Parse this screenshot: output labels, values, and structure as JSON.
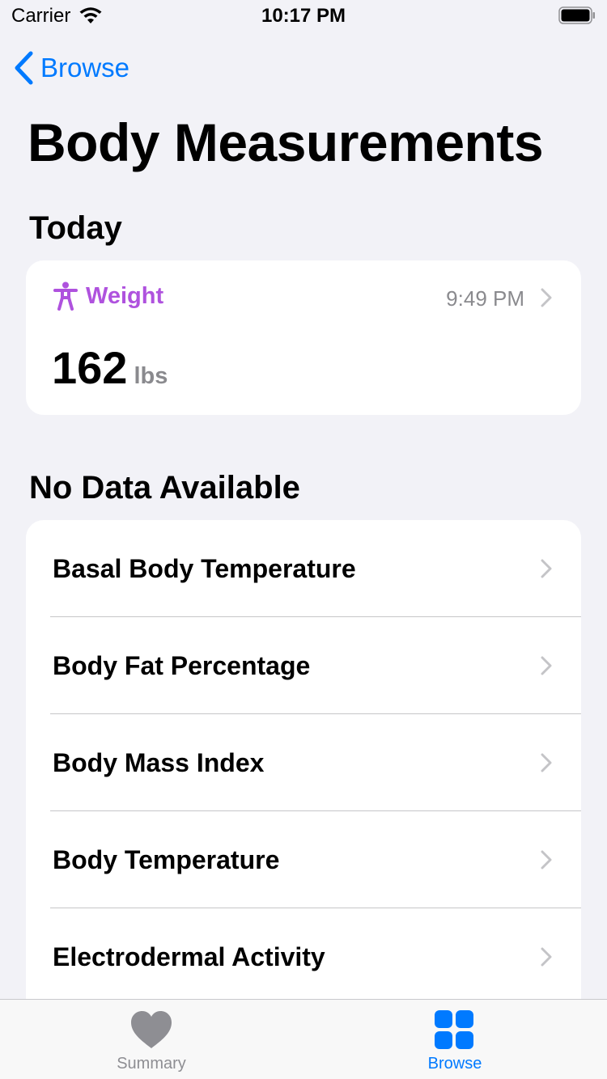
{
  "status_bar": {
    "carrier": "Carrier",
    "time": "10:17 PM"
  },
  "nav": {
    "back_label": "Browse",
    "title": "Body Measurements"
  },
  "today": {
    "heading": "Today",
    "weight": {
      "label": "Weight",
      "time": "9:49 PM",
      "value": "162",
      "unit": "lbs",
      "accent": "#af52de"
    }
  },
  "no_data": {
    "heading": "No Data Available",
    "items": [
      {
        "label": "Basal Body Temperature"
      },
      {
        "label": "Body Fat Percentage"
      },
      {
        "label": "Body Mass Index"
      },
      {
        "label": "Body Temperature"
      },
      {
        "label": "Electrodermal Activity"
      }
    ]
  },
  "tab_bar": {
    "tabs": [
      {
        "label": "Summary",
        "icon": "heart-icon",
        "selected": false
      },
      {
        "label": "Browse",
        "icon": "grid-icon",
        "selected": true
      }
    ]
  },
  "colors": {
    "accent": "#007aff",
    "background": "#f2f2f7"
  }
}
